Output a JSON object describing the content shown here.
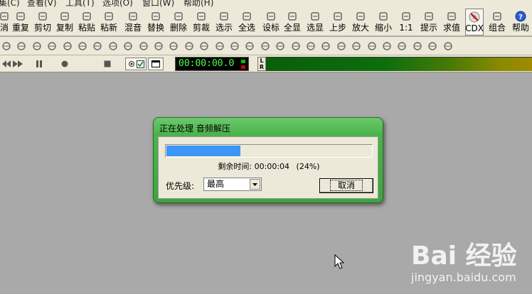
{
  "menubar": {
    "items": [
      "集(C)",
      "查看(V)",
      "工具(T)",
      "选项(O)",
      "窗口(W)",
      "帮助(H)"
    ]
  },
  "toolbar": {
    "buttons": [
      {
        "label": "消",
        "icon": "undo-icon"
      },
      {
        "label": "重复",
        "icon": "redo-icon"
      },
      {
        "label": "剪切",
        "icon": "scissors-icon"
      },
      {
        "label": "复制",
        "icon": "copy-icon"
      },
      {
        "label": "粘贴",
        "icon": "paste-icon"
      },
      {
        "label": "粘新",
        "icon": "paste-new-icon"
      },
      {
        "label": "混音",
        "icon": "mix-paste-icon"
      },
      {
        "label": "替换",
        "icon": "replace-icon"
      },
      {
        "label": "删除",
        "icon": "delete-icon"
      },
      {
        "label": "剪裁",
        "icon": "trim-icon"
      },
      {
        "label": "选示",
        "icon": "select-view-icon"
      },
      {
        "label": "全选",
        "icon": "select-all-icon"
      },
      {
        "label": "设标",
        "icon": "marker-icon"
      },
      {
        "label": "全显",
        "icon": "zoom-all-icon"
      },
      {
        "label": "选显",
        "icon": "zoom-selection-icon"
      },
      {
        "label": "上步",
        "icon": "zoom-previous-icon"
      },
      {
        "label": "放大",
        "icon": "zoom-in-icon"
      },
      {
        "label": "缩小",
        "icon": "zoom-out-icon"
      },
      {
        "label": "1:1",
        "icon": "zoom-1to1-icon"
      },
      {
        "label": "提示",
        "icon": "hint-icon"
      },
      {
        "label": "求值",
        "icon": "evaluate-icon"
      },
      {
        "label": "CDX",
        "icon": "cdx-icon"
      },
      {
        "label": "组合",
        "icon": "combine-icon"
      },
      {
        "label": "帮助",
        "icon": "help-icon"
      }
    ]
  },
  "transport": {
    "time": "00:00:00.0",
    "lr_top": "L",
    "lr_bottom": "R"
  },
  "dialog": {
    "title": "正在处理 音频解压",
    "progress": 0.24,
    "remaining_label": "剩余时间:",
    "remaining_time": "00:00:04",
    "percent_text": "(24%)",
    "priority_label": "优先级:",
    "priority_value": "最高",
    "cancel_label": "取消"
  },
  "watermark": {
    "logo": "Bai 经验",
    "sub": "jingyan.baidu.com"
  }
}
